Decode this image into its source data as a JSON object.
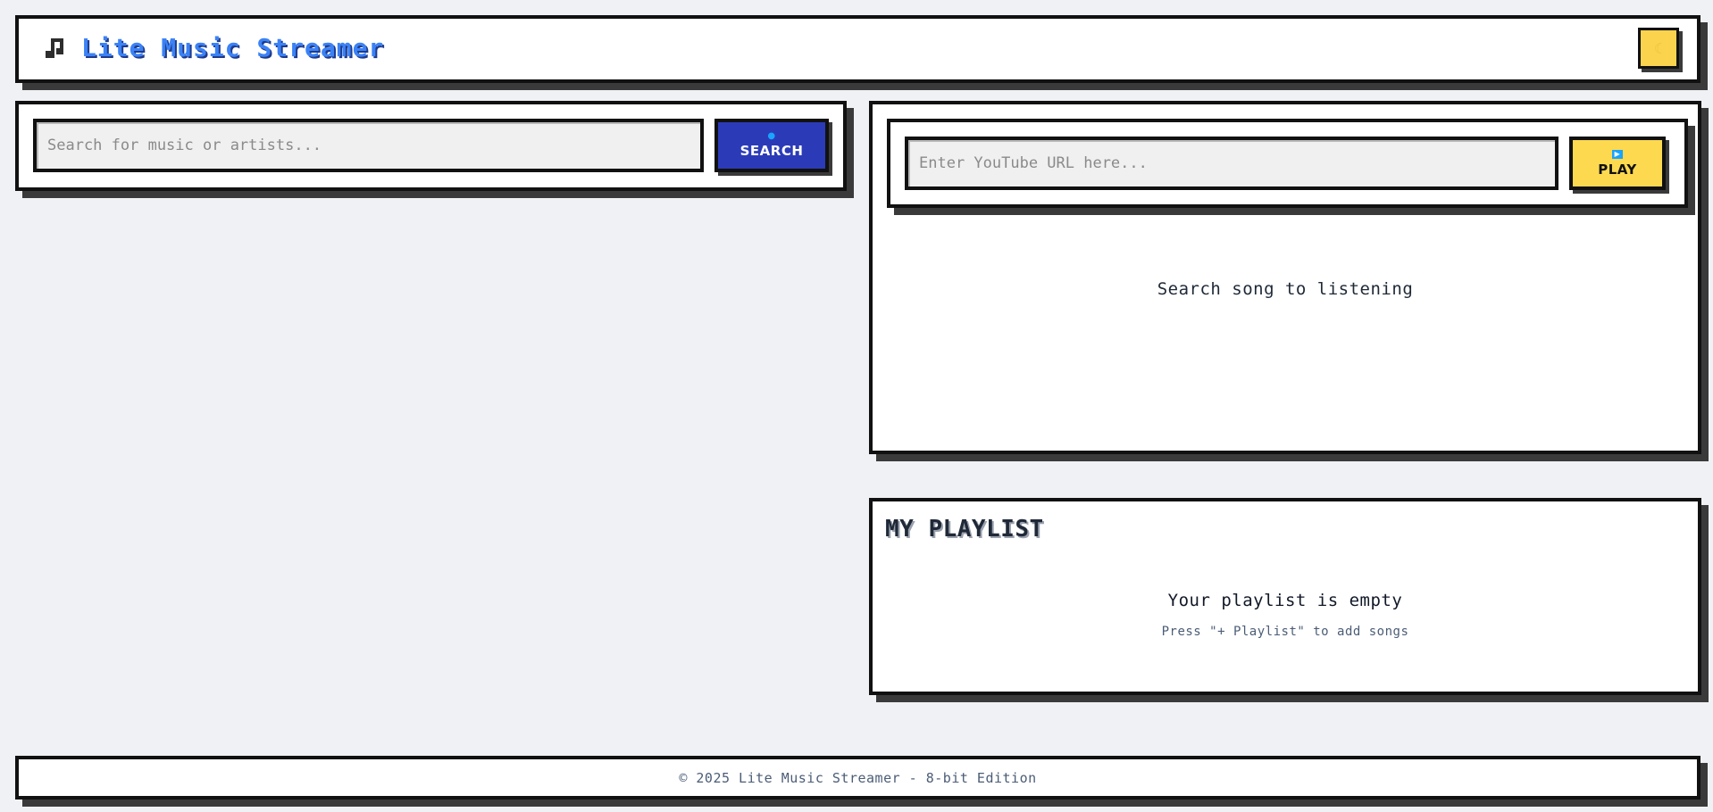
{
  "header": {
    "app_icon": "music-note-icon",
    "title": "Lite Music Streamer",
    "theme_toggle_icon": "moon-icon"
  },
  "search": {
    "placeholder": "Search for music or artists...",
    "button_icon": "magnifier-icon",
    "button_label": "SEARCH"
  },
  "player": {
    "url_placeholder": "Enter YouTube URL here...",
    "play_icon": "play-icon",
    "play_label": "PLAY",
    "empty_message": "Search song to listening"
  },
  "playlist": {
    "title": "MY PLAYLIST",
    "empty_message": "Your playlist is empty",
    "hint": "Press \"+ Playlist\" to add songs"
  },
  "footer": {
    "text": "© 2025 Lite Music Streamer - 8-bit Edition"
  },
  "colors": {
    "background": "#f0f1f4",
    "title_blue": "#3b82f6",
    "search_button": "#2b3bb8",
    "play_button": "#fcd94f",
    "theme_toggle": "#fcd34d",
    "border": "#111111",
    "shadow": "#3a3a3a"
  }
}
